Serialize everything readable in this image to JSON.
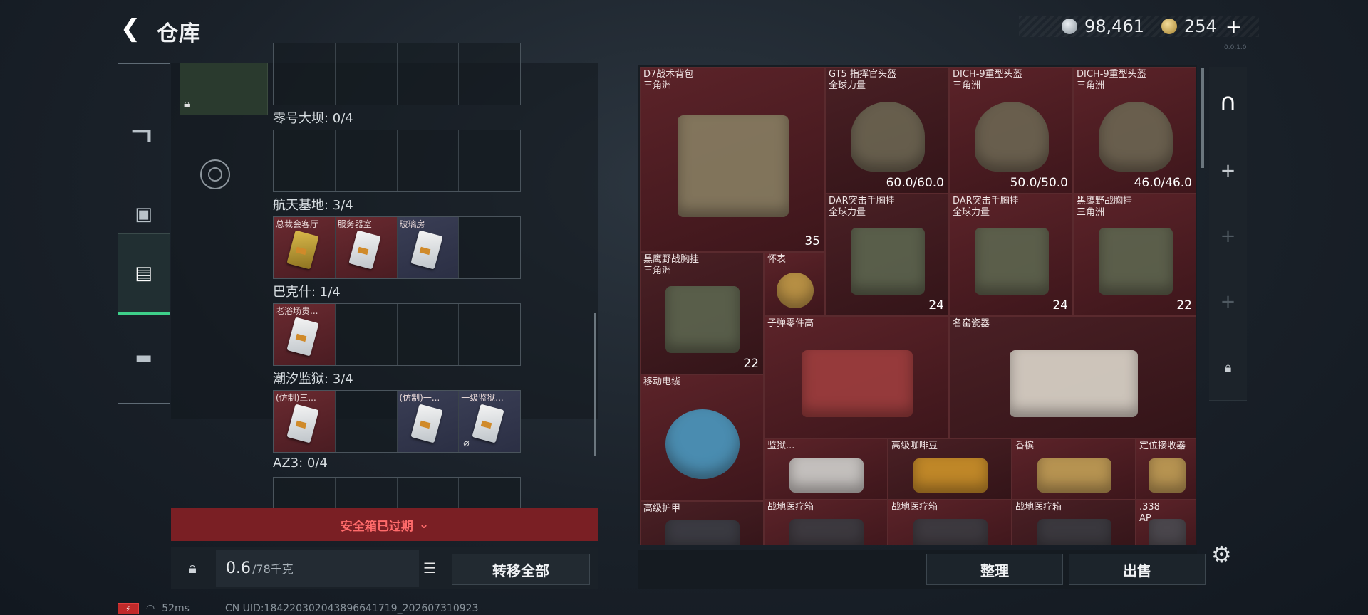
{
  "header": {
    "back_icon": "back-arrow-icon",
    "title": "仓库",
    "silver_amount": "98,461",
    "gold_amount": "254",
    "add_label": "+",
    "version": "0.0.1.0"
  },
  "nav": {
    "items": [
      {
        "name": "weapon",
        "icon": "gun-icon"
      },
      {
        "name": "gear",
        "icon": "armor-icon"
      },
      {
        "name": "stash",
        "icon": "container-icon",
        "active": true
      },
      {
        "name": "toolbox",
        "icon": "toolbox-icon"
      }
    ]
  },
  "collection": {
    "regions": [
      {
        "label": "零号大坝: 0/4",
        "cells": [
          {
            "name": ""
          },
          {
            "name": ""
          },
          {
            "name": ""
          },
          {
            "name": ""
          }
        ]
      },
      {
        "label": "航天基地: 3/4",
        "cells": [
          {
            "name": "总裁会客厅",
            "tone": "red",
            "card": "gold"
          },
          {
            "name": "服务器室",
            "tone": "red",
            "card": "white"
          },
          {
            "name": "玻璃房",
            "tone": "blue",
            "card": "white"
          },
          {
            "name": ""
          }
        ]
      },
      {
        "label": "巴克什: 1/4",
        "cells": [
          {
            "name": "老浴场贵...",
            "tone": "red",
            "card": "white"
          },
          {
            "name": ""
          },
          {
            "name": ""
          },
          {
            "name": ""
          }
        ]
      },
      {
        "label": "潮汐监狱: 3/4",
        "cells": [
          {
            "name": "(仿制)三...",
            "tone": "red",
            "card": "white"
          },
          {
            "name": ""
          },
          {
            "name": "(仿制)一...",
            "tone": "blue",
            "card": "white"
          },
          {
            "name": "一级监狱...",
            "tone": "blue",
            "card": "white",
            "expired": true
          }
        ]
      },
      {
        "label": "AZ3: 0/4",
        "cells": [
          {
            "name": ""
          },
          {
            "name": ""
          },
          {
            "name": ""
          },
          {
            "name": ""
          }
        ]
      }
    ],
    "safe_box_status": "安全箱已过期",
    "weight_value": "0.6",
    "weight_max": "/78千克",
    "transfer_all": "转移全部"
  },
  "stash": {
    "items": [
      {
        "line1": "D7战术背包",
        "line2": "三角洲",
        "value": "35",
        "icon": "backpack-icon"
      },
      {
        "line1": "GT5 指挥官头盔",
        "line2": "全球力量",
        "value": "60.0/60.0",
        "icon": "helmet-icon"
      },
      {
        "line1": "DICH-9重型头盔",
        "line2": "三角洲",
        "value": "50.0/50.0",
        "icon": "helmet-icon"
      },
      {
        "line1": "DICH-9重型头盔",
        "line2": "三角洲",
        "value": "46.0/46.0",
        "icon": "helmet-icon"
      },
      {
        "line1": "DAR突击手胸挂",
        "line2": "全球力量",
        "value": "24",
        "icon": "chest-rig-icon"
      },
      {
        "line1": "DAR突击手胸挂",
        "line2": "全球力量",
        "value": "24",
        "icon": "chest-rig-icon"
      },
      {
        "line1": "黑鹰野战胸挂",
        "line2": "三角洲",
        "value": "22",
        "icon": "chest-rig-icon"
      },
      {
        "line1": "黑鹰野战胸挂",
        "line2": "三角洲",
        "value": "22",
        "icon": "chest-rig-icon"
      },
      {
        "line1": "怀表",
        "line2": "",
        "value": "",
        "icon": "pocket-watch-icon"
      },
      {
        "line1": "子弹零件高",
        "line2": "",
        "value": "",
        "icon": "ammo-parts-icon"
      },
      {
        "line1": "名窑瓷器",
        "line2": "",
        "value": "",
        "icon": "porcelain-vase-icon"
      },
      {
        "line1": "移动电缆",
        "line2": "",
        "value": "",
        "icon": "cable-reel-icon"
      },
      {
        "line1": "监狱...",
        "line2": "",
        "value": "",
        "icon": "blueprint-icon"
      },
      {
        "line1": "高级咖啡豆",
        "line2": "",
        "value": "",
        "icon": "coffee-icon"
      },
      {
        "line1": "香槟",
        "line2": "",
        "value": "",
        "icon": "champagne-icon"
      },
      {
        "line1": "定位接收器",
        "line2": "",
        "value": "",
        "icon": "receiver-icon"
      },
      {
        "line1": "高级护甲",
        "line2": "",
        "value": "",
        "icon": "armor-icon"
      },
      {
        "line1": "战地医疗箱",
        "line2": "",
        "value": "",
        "icon": "medkit-icon"
      },
      {
        "line1": "战地医疗箱",
        "line2": "",
        "value": "",
        "icon": "medkit-icon"
      },
      {
        "line1": "战地医疗箱",
        "line2": "",
        "value": "",
        "icon": "medkit-icon"
      },
      {
        "line1": ".338",
        "line2": "AP",
        "value": "",
        "icon": "ammo-icon"
      }
    ],
    "sort_label": "整理",
    "sell_label": "出售"
  },
  "status": {
    "ping": "52ms",
    "uid": "CN UID:1842203020438966417​19_202607310923"
  }
}
